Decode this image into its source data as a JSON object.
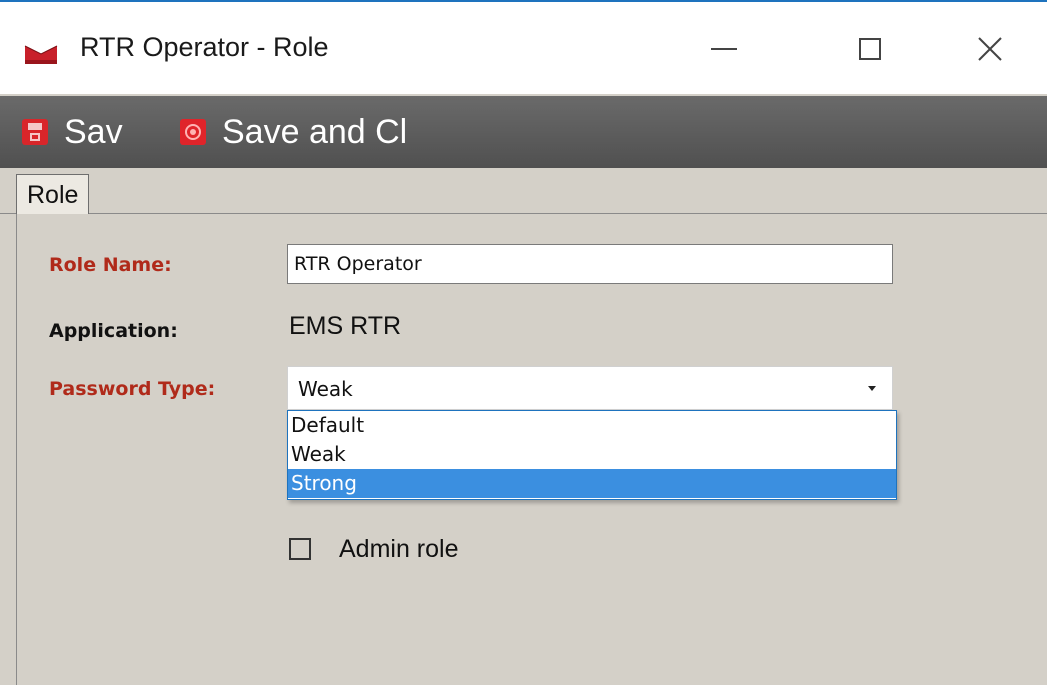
{
  "window": {
    "title": "RTR Operator - Role",
    "app_icon": "folder-tray-icon",
    "controls": {
      "minimize": "minimize-icon",
      "maximize": "maximize-icon",
      "close_glyph": "✕"
    }
  },
  "toolbar": {
    "save_label": "Sav",
    "save_icon": "save-icon",
    "save_close_label": "Save and Cl",
    "save_close_icon": "save-close-icon"
  },
  "tabs": [
    {
      "label": "Role",
      "active": true
    }
  ],
  "form": {
    "role_name": {
      "label": "Role Name:",
      "value": "RTR Operator",
      "required": true
    },
    "application": {
      "label": "Application:",
      "value": "EMS RTR"
    },
    "password_type": {
      "label": "Password Type:",
      "value": "Weak",
      "required": true,
      "options": [
        "Default",
        "Weak",
        "Strong"
      ],
      "highlighted_option": "Strong"
    },
    "admin_role": {
      "label": "Admin role",
      "checked": false
    }
  },
  "colors": {
    "accent": "#1e73be",
    "required_label": "#b02a1a",
    "toolbar_bg": "#5a5a5a",
    "highlight": "#3b8fe0",
    "panel_bg": "#d4d0c8"
  }
}
